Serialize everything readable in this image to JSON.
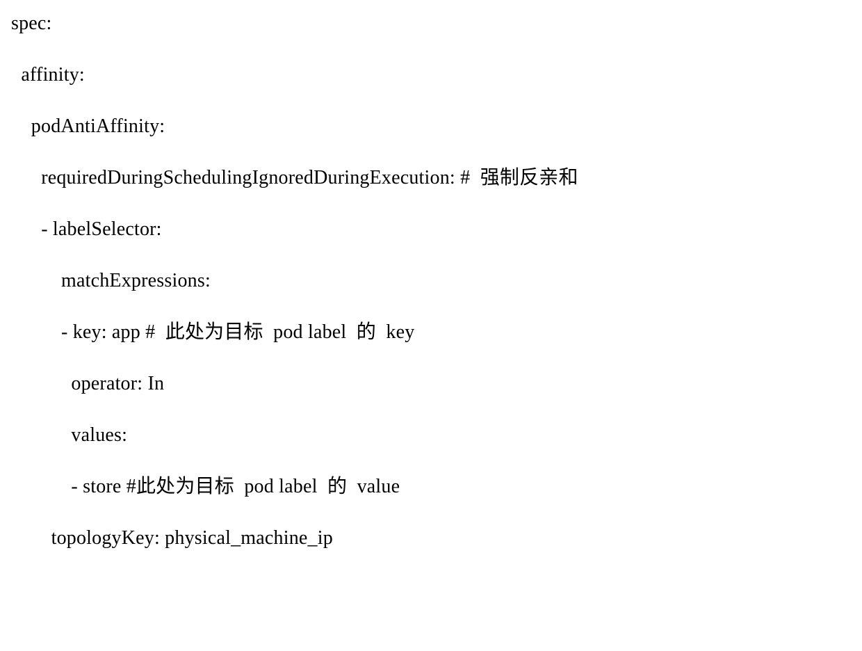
{
  "lines": [
    "spec:",
    "  affinity:",
    "    podAntiAffinity:",
    "      requiredDuringSchedulingIgnoredDuringExecution: #  强制反亲和",
    "      - labelSelector:",
    "          matchExpressions:",
    "          - key: app #  此处为目标  pod label  的  key",
    "            operator: In",
    "            values:",
    "            - store #此处为目标  pod label  的  value",
    "        topologyKey: physical_machine_ip"
  ]
}
